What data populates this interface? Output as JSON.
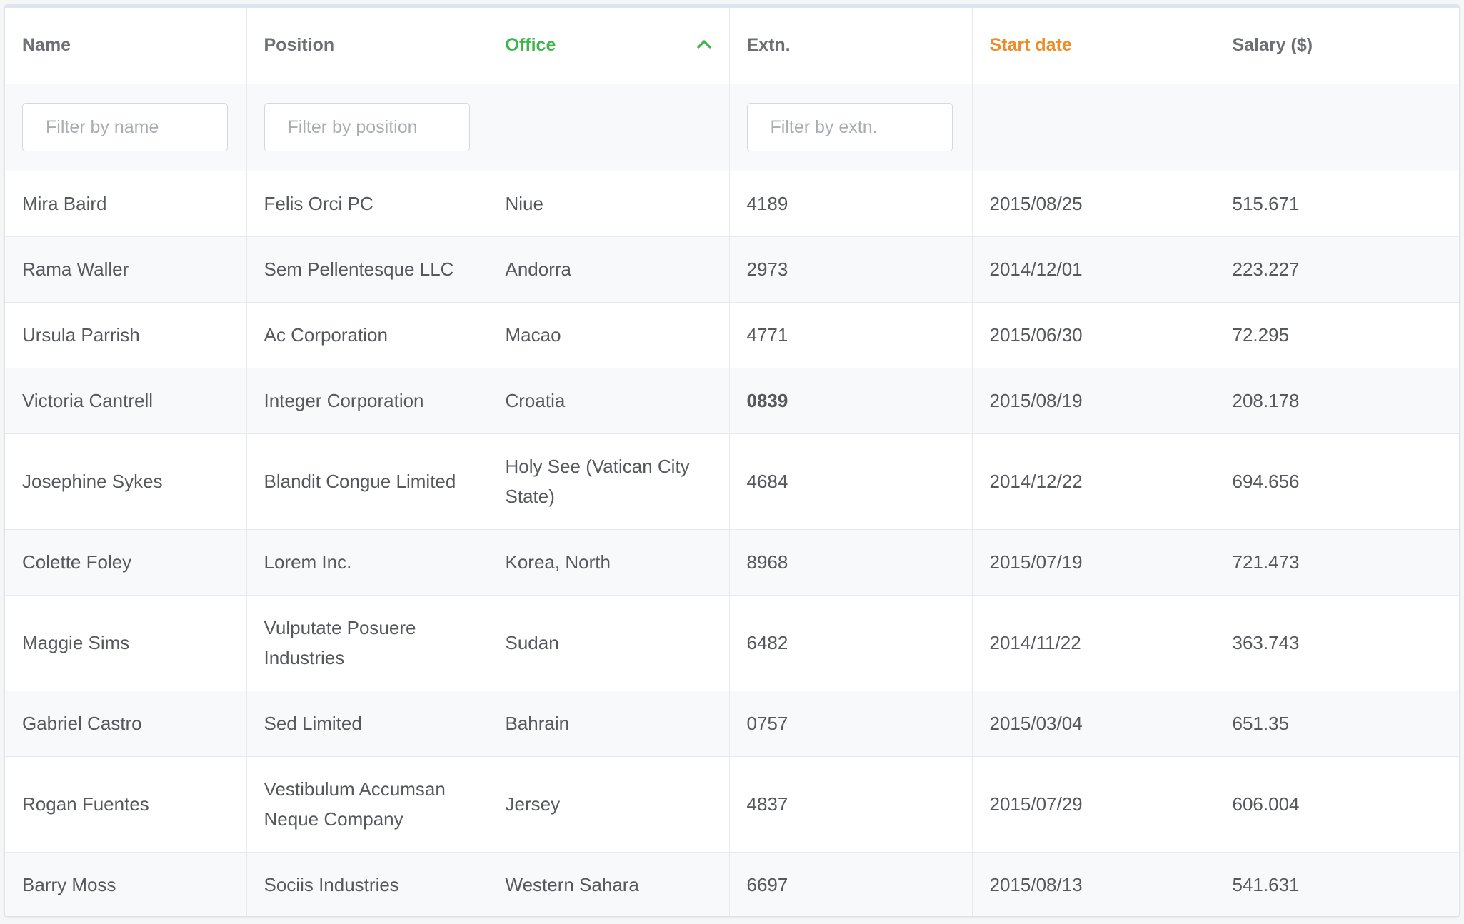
{
  "table": {
    "columns": [
      {
        "label": "Name",
        "state": "default"
      },
      {
        "label": "Position",
        "state": "default"
      },
      {
        "label": "Office",
        "state": "sorted-ascending"
      },
      {
        "label": "Extn.",
        "state": "default"
      },
      {
        "label": "Start date",
        "state": "highlighted"
      },
      {
        "label": "Salary ($)",
        "state": "default"
      }
    ],
    "sort_icon": "chevron-up-icon",
    "colors": {
      "sorted": "#3cb54a",
      "highlighted": "#f08a24",
      "header_text": "#6c6f74",
      "cell_text": "#55585c",
      "zebra": "#f8f9fb"
    },
    "filters": {
      "name_placeholder": "Filter by name",
      "position_placeholder": "Filter by position",
      "extn_placeholder": "Filter by extn."
    },
    "rows": [
      [
        "Mira Baird",
        "Felis Orci PC",
        "Niue",
        "4189",
        "2015/08/25",
        "515.671"
      ],
      [
        "Rama Waller",
        "Sem Pellentesque LLC",
        "Andorra",
        "2973",
        "2014/12/01",
        "223.227"
      ],
      [
        "Ursula Parrish",
        "Ac Corporation",
        "Macao",
        "4771",
        "2015/06/30",
        "72.295"
      ],
      [
        "Victoria Cantrell",
        "Integer Corporation",
        "Croatia",
        "0839",
        "2015/08/19",
        "208.178"
      ],
      [
        "Josephine Sykes",
        "Blandit Congue Limited",
        "Holy See (Vatican City State)",
        "4684",
        "2014/12/22",
        "694.656"
      ],
      [
        "Colette Foley",
        "Lorem Inc.",
        "Korea, North",
        "8968",
        "2015/07/19",
        "721.473"
      ],
      [
        "Maggie Sims",
        "Vulputate Posuere Industries",
        "Sudan",
        "6482",
        "2014/11/22",
        "363.743"
      ],
      [
        "Gabriel Castro",
        "Sed Limited",
        "Bahrain",
        "0757",
        "2015/03/04",
        "651.35"
      ],
      [
        "Rogan Fuentes",
        "Vestibulum Accumsan Neque Company",
        "Jersey",
        "4837",
        "2015/07/29",
        "606.004"
      ],
      [
        "Barry Moss",
        "Sociis Industries",
        "Western Sahara",
        "6697",
        "2015/08/13",
        "541.631"
      ]
    ]
  }
}
